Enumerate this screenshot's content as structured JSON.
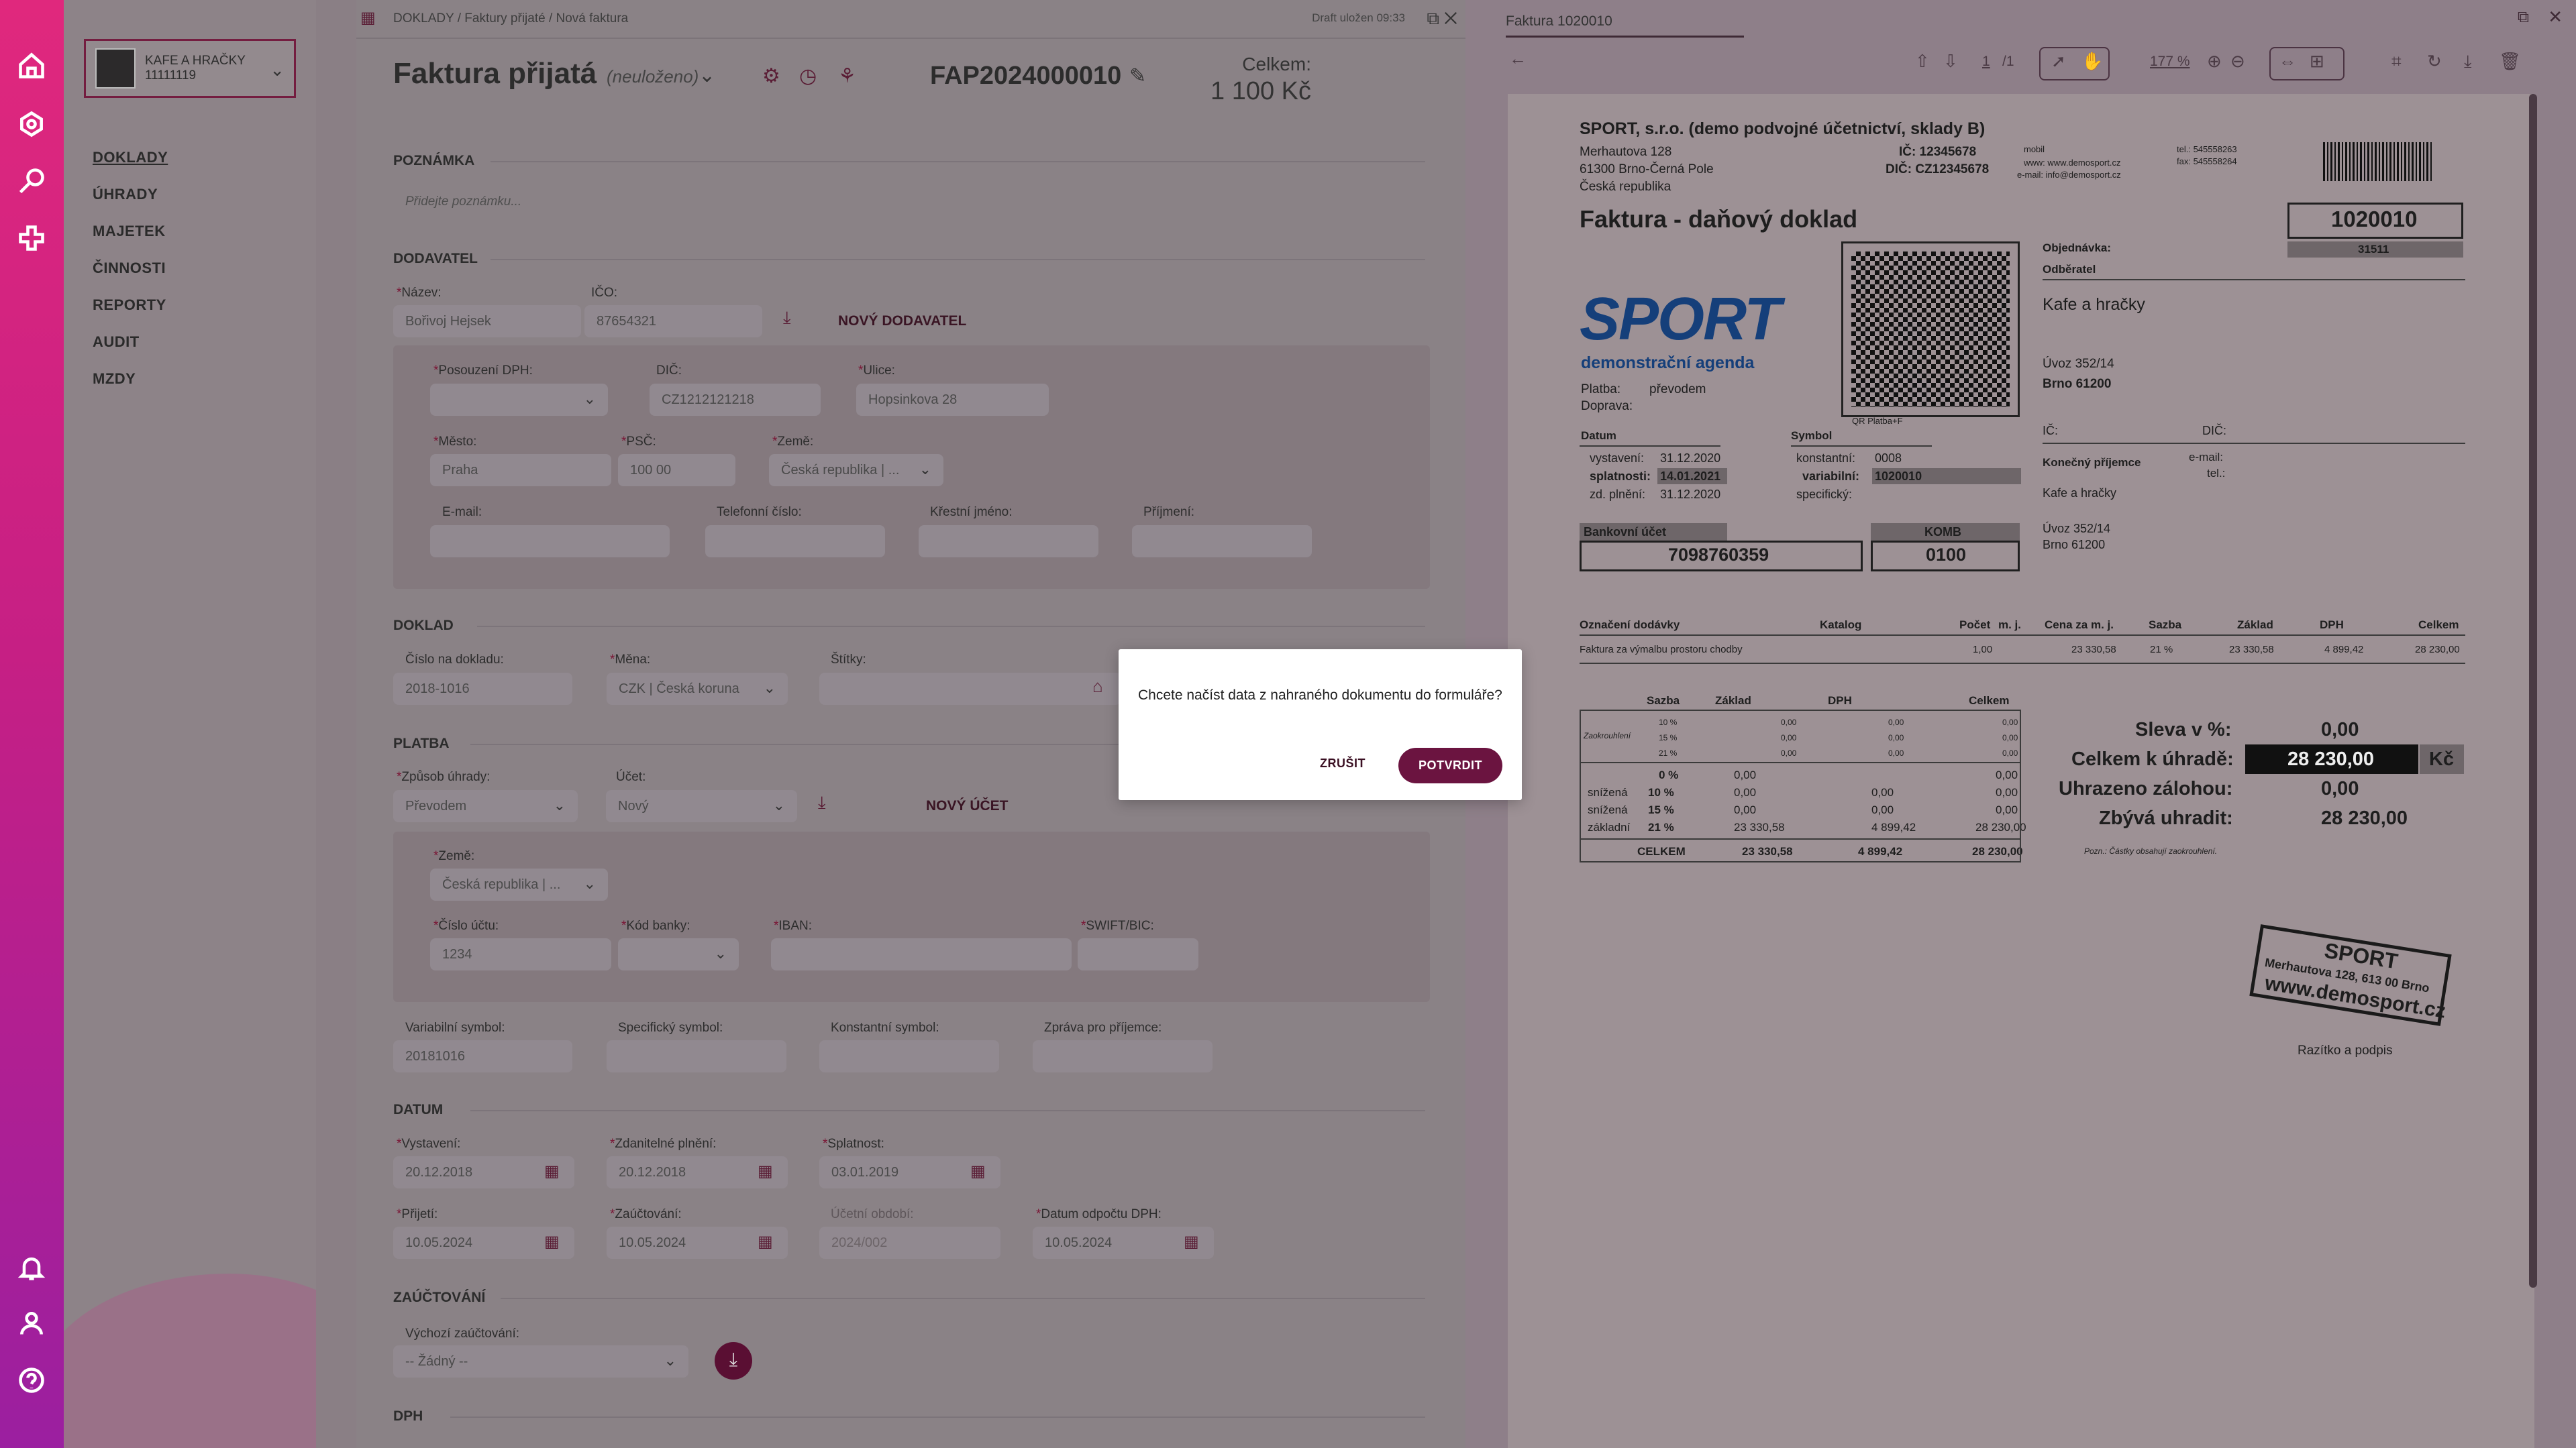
{
  "rail": {
    "icons": [
      "home-icon",
      "settings-icon",
      "search-icon",
      "plus-icon",
      "bell-icon",
      "user-icon",
      "help-icon"
    ]
  },
  "company": {
    "name": "KAFE A HRAČKY",
    "id": "11111119"
  },
  "nav": {
    "items": [
      "DOKLADY",
      "ÚHRADY",
      "MAJETEK",
      "ČINNOSTI",
      "REPORTY",
      "AUDIT",
      "MZDY"
    ]
  },
  "form": {
    "breadcrumb": "DOKLADY  /  Faktury přijaté  /  Nová faktura",
    "draft": "Draft uložen 09:33",
    "title": "Faktura přijatá",
    "state": "(neuloženo)",
    "doc_number": "FAP2024000010",
    "total_label": "Celkem:",
    "total_value": "1 100 Kč",
    "sections": {
      "note": "POZNÁMKA",
      "supplier": "DODAVATEL",
      "document": "DOKLAD",
      "payment": "PLATBA",
      "date": "DATUM",
      "accounting": "ZAÚČTOVÁNÍ",
      "vat": "DPH"
    },
    "note_placeholder": "Přidejte poznámku...",
    "supplier": {
      "name_label": "Název:",
      "name": "Bořivoj Hejsek",
      "ico_label": "IČO:",
      "ico": "87654321",
      "new_supplier": "NOVÝ DODAVATEL",
      "vat_label": "Posouzení DPH:",
      "dic_label": "DIČ:",
      "dic": "CZ1212121218",
      "street_label": "Ulice:",
      "street": "Hopsinkova 28",
      "city_label": "Město:",
      "city": "Praha",
      "zip_label": "PSČ:",
      "zip": "100  00",
      "country_label": "Země:",
      "country": "Česká republika | ...",
      "email_label": "E-mail:",
      "phone_label": "Telefonní číslo:",
      "firstname_label": "Křestní jméno:",
      "lastname_label": "Příjmení:"
    },
    "document": {
      "number_label": "Číslo na dokladu:",
      "number": "2018-1016",
      "currency_label": "Měna:",
      "currency": "CZK | Česká koruna",
      "tags_label": "Štítky:"
    },
    "payment": {
      "method_label": "Způsob úhrady:",
      "method": "Převodem",
      "account_label": "Účet:",
      "account": "Nový",
      "new_account": "NOVÝ ÚČET",
      "country_label": "Země:",
      "country": "Česká republika | ...",
      "accno_label": "Číslo účtu:",
      "accno": "1234",
      "bank_label": "Kód banky:",
      "iban_label": "IBAN:",
      "swift_label": "SWIFT/BIC:",
      "vs_label": "Variabilní symbol:",
      "vs": "20181016",
      "ss_label": "Specifický symbol:",
      "ks_label": "Konstantní symbol:",
      "msg_label": "Zpráva pro příjemce:"
    },
    "dates": {
      "issued_label": "Vystavení:",
      "issued": "20.12.2018",
      "taxable_label": "Zdanitelné plnění:",
      "taxable": "20.12.2018",
      "due_label": "Splatnost:",
      "due": "03.01.2019",
      "received_label": "Přijetí:",
      "received": "10.05.2024",
      "posted_label": "Zaúčtování:",
      "posted": "10.05.2024",
      "period_label": "Účetní období:",
      "period": "2024/002",
      "vatdate_label": "Datum odpočtu DPH:",
      "vatdate": "10.05.2024"
    },
    "accounting": {
      "default_label": "Výchozí zaúčtování:",
      "default": "-- Žádný --"
    }
  },
  "viewer": {
    "tab": "Faktura 1020010",
    "page": "1",
    "pages": "/1",
    "zoom": "177 %",
    "invoice": {
      "seller": "SPORT, s.r.o. (demo podvojné účetnictví, sklady B)",
      "addr1": "Merhautova 128",
      "addr2": "61300  Brno-Černá Pole",
      "addr3": "Česká republika",
      "ic": "IČ:  12345678",
      "dic": "DIČ:  CZ12345678",
      "mobil": "mobil",
      "www": "www: www.demosport.cz",
      "email": "e-mail: info@demosport.cz",
      "tel": "tel.:  545558263",
      "fax": "fax:  545558264",
      "title": "Faktura - daňový doklad",
      "number": "1020010",
      "order_label": "Objednávka:",
      "order": "31511",
      "buyer_label": "Odběratel",
      "buyer": "Kafe a hračky",
      "buyer_addr1": "Úvoz 352/14",
      "buyer_addr2": "Brno  61200",
      "logo_text": "SPORT",
      "logo_sub": "demonstrační agenda",
      "payment_label": "Platba:",
      "payment": "převodem",
      "delivery_label": "Doprava:",
      "qr_label": "QR Platba+F",
      "date_head": "Datum",
      "issued_label": "vystavení:",
      "issued": "31.12.2020",
      "due_label": "splatnosti:",
      "due": "14.01.2021",
      "duzp_label": "zd. plnění:",
      "duzp": "31.12.2020",
      "symbol_head": "Symbol",
      "const_label": "konstantní:",
      "const": "0008",
      "var_label": "variabilní:",
      "var": "1020010",
      "spec_label": "specifický:",
      "ic_label": "IČ:",
      "dic_label": "DIČ:",
      "final_label": "Konečný příjemce",
      "final": "Kafe a hračky",
      "final_email": "e-mail:",
      "final_tel": "tel.:",
      "final_addr1": "Úvoz 352/14",
      "final_addr2": "Brno  61200",
      "bank_label": "Bankovní účet",
      "bank": "7098760359",
      "komb_label": "KOMB",
      "komb": "0100",
      "items_head": [
        "Označení dodávky",
        "Katalog",
        "Počet",
        "m. j.",
        "Cena za m. j.",
        "Sazba",
        "Základ",
        "DPH",
        "Celkem"
      ],
      "item": [
        "Faktura za výmalbu prostoru chodby",
        "1,00",
        "23 330,58",
        "21  %",
        "23 330,58",
        "4 899,42",
        "28 230,00"
      ],
      "vat_head": [
        "Sazba",
        "Základ",
        "DPH",
        "Celkem"
      ],
      "zaokr_label": "Zaokrouhlení",
      "zaokr_rows": [
        [
          "10  %",
          "0,00",
          "0,00",
          "0,00"
        ],
        [
          "15  %",
          "0,00",
          "0,00",
          "0,00"
        ],
        [
          "21  %",
          "0,00",
          "0,00",
          "0,00"
        ]
      ],
      "vat_rows": [
        [
          "",
          "0  %",
          "0,00",
          "",
          "0,00"
        ],
        [
          "snížená",
          "10  %",
          "0,00",
          "0,00",
          "0,00"
        ],
        [
          "snížená",
          "15  %",
          "0,00",
          "0,00",
          "0,00"
        ],
        [
          "základní",
          "21  %",
          "23 330,58",
          "4 899,42",
          "28 230,00"
        ]
      ],
      "vat_total": [
        "CELKEM",
        "23 330,58",
        "4 899,42",
        "28 230,00"
      ],
      "discount_label": "Sleva v %:",
      "discount": "0,00",
      "topay_label": "Celkem k úhradě:",
      "topay": "28 230,00",
      "currency": "Kč",
      "advance_label": "Uhrazeno zálohou:",
      "advance": "0,00",
      "remain_label": "Zbývá uhradit:",
      "remain": "28 230,00",
      "note": "Pozn.: Částky obsahují zaokrouhlení.",
      "stamp1": "SPORT",
      "stamp2": "Merhautova 128, 613 00  Brno",
      "stamp3": "www.demosport.cz",
      "sign_label": "Razítko a podpis"
    }
  },
  "modal": {
    "message": "Chcete načíst data z nahraného dokumentu do formuláře?",
    "cancel": "ZRUŠIT",
    "confirm": "POTVRDIT"
  },
  "colors": {
    "accent": "#6b1440",
    "rail_top": "#e0287d",
    "rail_bottom": "#9b1fa0"
  }
}
